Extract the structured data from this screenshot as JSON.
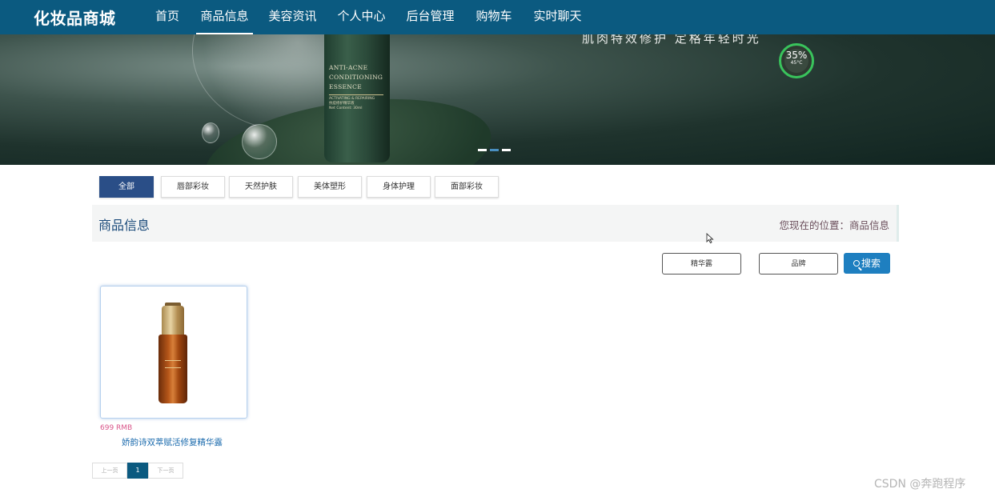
{
  "brand": "化妆品商城",
  "nav": {
    "items": [
      {
        "label": "首页",
        "active": false
      },
      {
        "label": "商品信息",
        "active": true
      },
      {
        "label": "美容资讯",
        "active": false
      },
      {
        "label": "个人中心",
        "active": false
      },
      {
        "label": "后台管理",
        "active": false
      },
      {
        "label": "购物车",
        "active": false
      },
      {
        "label": "实时聊天",
        "active": false
      }
    ]
  },
  "banner": {
    "slogan": "肌肉特效修护  定格年轻时光",
    "bottle_text": [
      "ANTI-ACNE",
      "CONDITIONING",
      "ESSENCE"
    ],
    "bottle_subtext": [
      "ACTIVATING & REPAIRING",
      "抗痘修护精华液",
      "Net Content: 30ml"
    ],
    "badge_value": "35%",
    "badge_temp": "45°C",
    "slides_total": 3,
    "slide_active": 2
  },
  "categories": [
    {
      "label": "全部",
      "active": true
    },
    {
      "label": "唇部彩妆",
      "active": false
    },
    {
      "label": "天然护肤",
      "active": false
    },
    {
      "label": "美体塑形",
      "active": false
    },
    {
      "label": "身体护理",
      "active": false
    },
    {
      "label": "面部彩妆",
      "active": false
    }
  ],
  "section": {
    "title": "商品信息",
    "breadcrumb": "您现在的位置：商品信息"
  },
  "search": {
    "name_placeholder": "精华露",
    "brand_placeholder": "品牌",
    "button_label": "搜索"
  },
  "products": [
    {
      "price": "699 RMB",
      "name": "娇韵诗双萃赋活修复精华露"
    }
  ],
  "pagination": {
    "prev": "上一页",
    "current": "1",
    "next": "下一页"
  },
  "watermark": "CSDN @奔跑程序",
  "colors": {
    "nav_bg": "#0b5a80",
    "active_category": "#2a4e87",
    "search_button": "#1e7fc0",
    "price": "#d9558a",
    "product_name": "#1d6cae"
  }
}
